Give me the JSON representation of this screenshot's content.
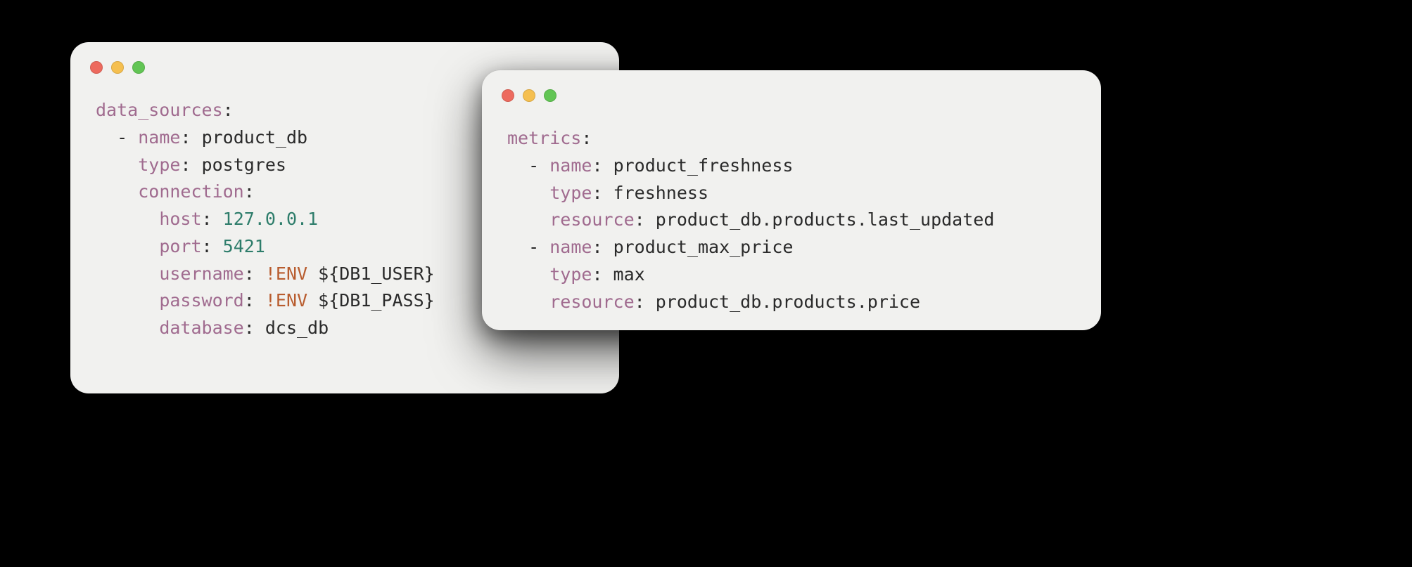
{
  "window1": {
    "code": {
      "root_key": "data_sources",
      "items": [
        {
          "name_key": "name",
          "name_val": "product_db",
          "type_key": "type",
          "type_val": "postgres",
          "conn_key": "connection",
          "host_key": "host",
          "host_val": "127.0.0.1",
          "port_key": "port",
          "port_val": "5421",
          "user_key": "username",
          "user_env": "!ENV",
          "user_val": "${DB1_USER}",
          "pass_key": "password",
          "pass_env": "!ENV",
          "pass_val": "${DB1_PASS}",
          "db_key": "database",
          "db_val": "dcs_db"
        }
      ]
    }
  },
  "window2": {
    "code": {
      "root_key": "metrics",
      "items": [
        {
          "name_key": "name",
          "name_val": "product_freshness",
          "type_key": "type",
          "type_val": "freshness",
          "res_key": "resource",
          "res_val": "product_db.products.last_updated"
        },
        {
          "name_key": "name",
          "name_val": "product_max_price",
          "type_key": "type",
          "type_val": "max",
          "res_key": "resource",
          "res_val": "product_db.products.price"
        }
      ]
    }
  }
}
